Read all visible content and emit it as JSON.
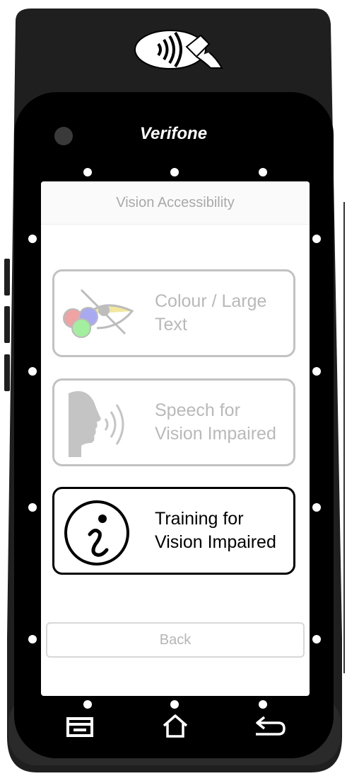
{
  "device": {
    "brand": "Verifone"
  },
  "header": {
    "title": "Vision Accessibility"
  },
  "options": [
    {
      "label": "Colour / Large\nText",
      "icon": "colour-large-text-icon",
      "enabled": false
    },
    {
      "label": "Speech for\nVision Impaired",
      "icon": "speech-icon",
      "enabled": false
    },
    {
      "label": "Training for\nVision Impaired",
      "icon": "info-icon",
      "enabled": true
    }
  ],
  "footer": {
    "back_label": "Back"
  },
  "nav": {
    "left": "recent-apps-icon",
    "center": "home-icon",
    "right": "back-arrow-icon"
  },
  "colors": {
    "body": "#1e1e1e",
    "frame": "#000000",
    "active_border": "#000000",
    "inactive": "#c2c2c2"
  }
}
